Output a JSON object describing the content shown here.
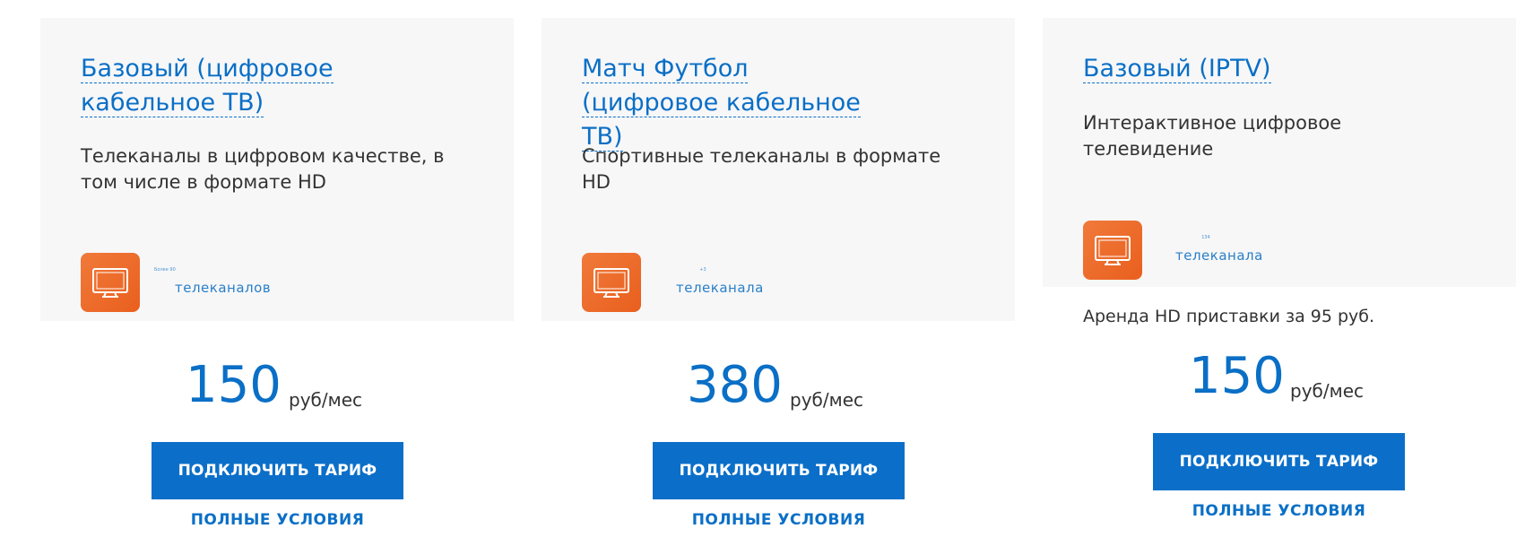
{
  "plans": [
    {
      "title": "Базовый (цифровое кабельное ТВ)",
      "description": "Телеканалы в цифровом качестве, в том числе в формате HD",
      "channels_small": "Более 90",
      "channels_label": "телеканалов",
      "price": "150",
      "price_unit": "руб/мес",
      "connect_label": "ПОДКЛЮЧИТЬ ТАРИФ",
      "conditions_label": "ПОЛНЫЕ УСЛОВИЯ"
    },
    {
      "title": "Матч Футбол (цифровое кабельное ТВ)",
      "description": "Спортивные телеканалы в формате HD",
      "channels_small": "+3",
      "channels_label": "телеканала",
      "price": "380",
      "price_unit": "руб/мес",
      "connect_label": "ПОДКЛЮЧИТЬ ТАРИФ",
      "conditions_label": "ПОЛНЫЕ УСЛОВИЯ"
    },
    {
      "title": "Базовый (IPTV)",
      "description": "Интерактивное цифровое телевидение",
      "channels_small": "134",
      "channels_label": "телеканала",
      "rent_note": "Аренда HD приставки за 95 руб.",
      "price": "150",
      "price_unit": "руб/мес",
      "connect_label": "ПОДКЛЮЧИТЬ ТАРИФ",
      "conditions_label": "ПОЛНЫЕ УСЛОВИЯ"
    }
  ],
  "colors": {
    "accent": "#0a6fc6",
    "button": "#0b6fc9",
    "icon_bg": "#e95f1e",
    "card_top_bg": "#f7f7f8"
  },
  "icons": [
    "tv-icon"
  ]
}
